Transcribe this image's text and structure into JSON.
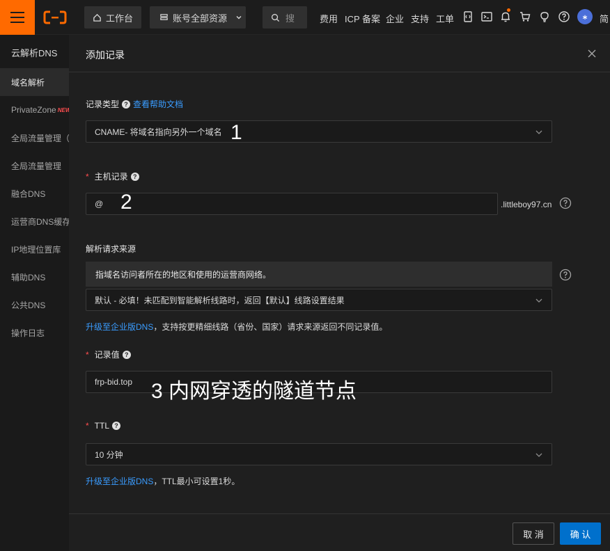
{
  "topbar": {
    "workbench_label": "工作台",
    "resources_label": "账号全部资源",
    "search_placeholder": "搜",
    "links": [
      "费用",
      "ICP 备案",
      "企业",
      "支持",
      "工单"
    ],
    "avatar_text": "⁎",
    "lang_label": "简"
  },
  "sidebar": {
    "title": "云解析DNS",
    "items": [
      {
        "label": "域名解析",
        "active": true
      },
      {
        "label": "PrivateZone",
        "badge": "NEW"
      },
      {
        "label": "全局流量管理（"
      },
      {
        "label": "全局流量管理"
      },
      {
        "label": "融合DNS"
      },
      {
        "label": "运营商DNS缓存"
      },
      {
        "label": "IP地理位置库"
      },
      {
        "label": "辅助DNS"
      },
      {
        "label": "公共DNS"
      },
      {
        "label": "操作日志"
      }
    ]
  },
  "panel": {
    "title": "添加记录",
    "record_type": {
      "label": "记录类型",
      "help_link": "查看帮助文档",
      "value": "CNAME- 将域名指向另外一个域名",
      "note": "1"
    },
    "host_record": {
      "label": "主机记录",
      "value": "@",
      "suffix": ".littleboy97.cn",
      "note": "2"
    },
    "request_source": {
      "label": "解析请求来源",
      "tooltip": "指域名访问者所在的地区和使用的运营商网络。",
      "value": "默认 - 必填！未匹配到智能解析线路时，返回【默认】线路设置结果",
      "upgrade_link": "升级至企业版DNS",
      "upgrade_text": "，支持按更精细线路（省份、国家）请求来源返回不同记录值。"
    },
    "record_value": {
      "label": "记录值",
      "value": "frp-bid.top",
      "note": "3 内网穿透的隧道节点"
    },
    "ttl": {
      "label": "TTL",
      "value": "10 分钟",
      "upgrade_link": "升级至企业版DNS",
      "upgrade_text": "，TTL最小可设置1秒。"
    },
    "cancel_label": "取 消",
    "ok_label": "确 认"
  },
  "colors": {
    "brand": "#ff6a00",
    "primary_button": "#0070cc",
    "link": "#3a9cff",
    "required": "#ff4d4f"
  }
}
